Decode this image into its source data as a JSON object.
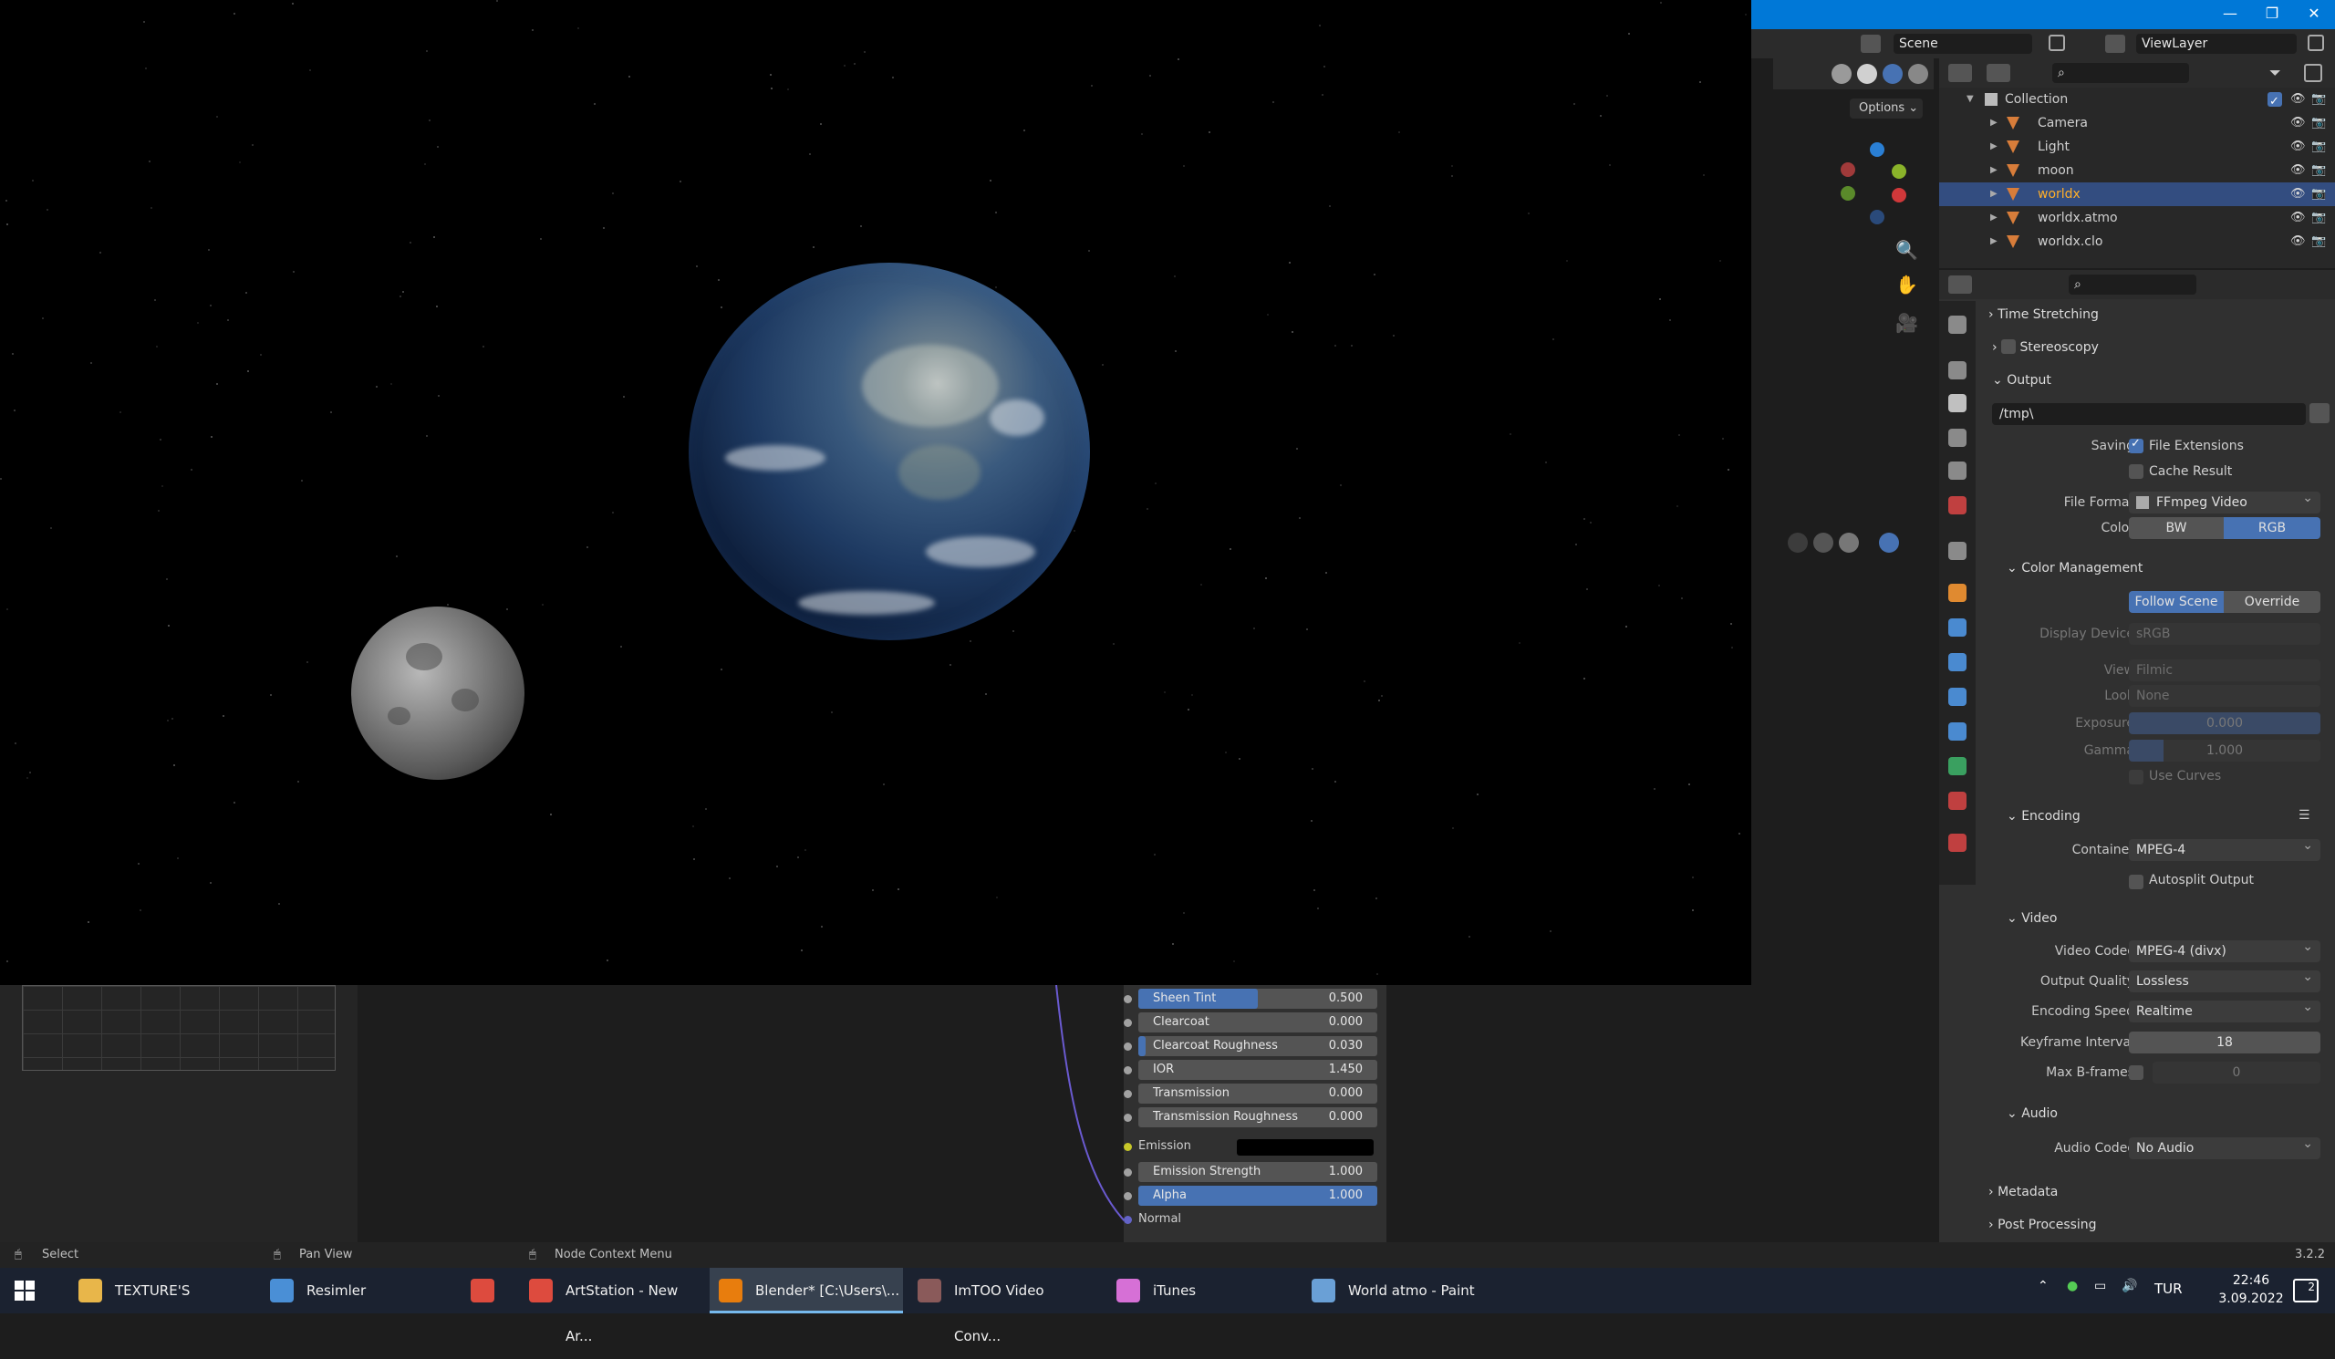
{
  "window": {
    "minimize": "—",
    "maximize": "❐",
    "close": "✕"
  },
  "topbar": {
    "scene": "Scene",
    "view_layer": "ViewLayer"
  },
  "viewport": {
    "options_label": "Options"
  },
  "outliner": {
    "collection": "Collection",
    "items": [
      {
        "name": "Camera",
        "selected": false
      },
      {
        "name": "Light",
        "selected": false
      },
      {
        "name": "moon",
        "selected": false
      },
      {
        "name": "worldx",
        "selected": true
      },
      {
        "name": "worldx.atmo",
        "selected": false
      },
      {
        "name": "worldx.clo",
        "selected": false
      }
    ]
  },
  "properties": {
    "time_stretching": "Time Stretching",
    "stereoscopy": "Stereoscopy",
    "output": "Output",
    "output_path": "/tmp\\",
    "saving_label": "Saving",
    "file_extensions": "File Extensions",
    "cache_result": "Cache Result",
    "file_format_label": "File Format",
    "file_format": "FFmpeg Video",
    "color_label": "Color",
    "color_bw": "BW",
    "color_rgb": "RGB",
    "color_management": "Color Management",
    "follow_scene": "Follow Scene",
    "override": "Override",
    "display_device_label": "Display Device",
    "display_device": "sRGB",
    "view_label": "View",
    "view": "Filmic",
    "look_label": "Look",
    "look": "None",
    "exposure_label": "Exposure",
    "exposure": "0.000",
    "gamma_label": "Gamma",
    "gamma": "1.000",
    "use_curves": "Use Curves",
    "encoding": "Encoding",
    "container_label": "Container",
    "container": "MPEG-4",
    "autosplit": "Autosplit Output",
    "video": "Video",
    "video_codec_label": "Video Codec",
    "video_codec": "MPEG-4 (divx)",
    "output_quality_label": "Output Quality",
    "output_quality": "Lossless",
    "encoding_speed_label": "Encoding Speed",
    "encoding_speed": "Realtime",
    "keyframe_interval_label": "Keyframe Interval",
    "keyframe_interval": "18",
    "max_bframes_label": "Max B-frames",
    "max_bframes": "0",
    "audio": "Audio",
    "audio_codec_label": "Audio Codec",
    "audio_codec": "No Audio",
    "metadata": "Metadata",
    "post_processing": "Post Processing"
  },
  "node": {
    "rows": [
      {
        "label": "Sheen Tint",
        "value": "0.500",
        "fill": 0.5
      },
      {
        "label": "Clearcoat",
        "value": "0.000",
        "fill": 0
      },
      {
        "label": "Clearcoat Roughness",
        "value": "0.030",
        "fill": 0.03
      },
      {
        "label": "IOR",
        "value": "1.450",
        "fill": 0
      },
      {
        "label": "Transmission",
        "value": "0.000",
        "fill": 0
      },
      {
        "label": "Transmission Roughness",
        "value": "0.000",
        "fill": 0
      }
    ],
    "emission": "Emission",
    "emission_strength_label": "Emission Strength",
    "emission_strength": "1.000",
    "alpha_label": "Alpha",
    "alpha": "1.000",
    "normal": "Normal"
  },
  "status": {
    "select": "Select",
    "pan_view": "Pan View",
    "node_context_menu": "Node Context Menu",
    "version": "3.2.2"
  },
  "taskbar": {
    "apps": [
      {
        "label": "TEXTURE'S",
        "color": "#e8b64a"
      },
      {
        "label": "Resimler",
        "color": "#4a8fd6"
      },
      {
        "label": "",
        "color": "#dd4b3e"
      },
      {
        "label": "ArtStation - New Ar...",
        "color": "#dd4b3e"
      },
      {
        "label": "Blender* [C:\\Users\\...",
        "color": "#e87d0d"
      },
      {
        "label": "ImTOO Video Conv...",
        "color": "#8a5a5a"
      },
      {
        "label": "iTunes",
        "color": "#d670d6"
      },
      {
        "label": "World atmo - Paint",
        "color": "#6aa0d6"
      }
    ],
    "lang": "TUR",
    "time": "22:46",
    "date": "3.09.2022",
    "notif_count": "2"
  }
}
